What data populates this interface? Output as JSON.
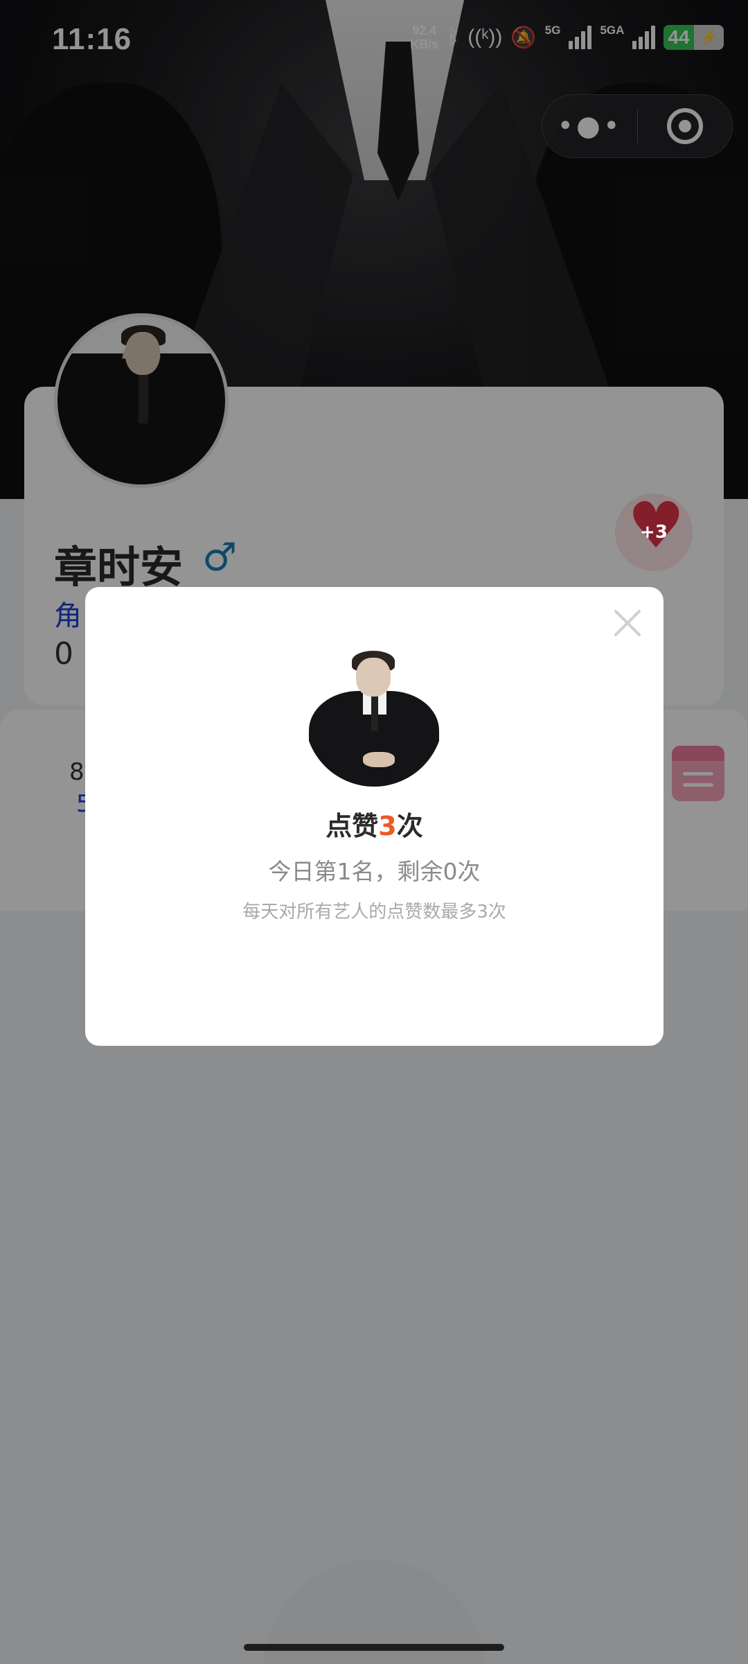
{
  "status_bar": {
    "time": "11:16",
    "net_speed_value": "92.4",
    "net_speed_unit": "KB/s",
    "network_1": "5G",
    "network_2": "5GA",
    "battery_level": "44"
  },
  "profile": {
    "name": "章时安",
    "gender_symbol": "♂",
    "role_partial": "角",
    "count_partial": "0",
    "like_badge": "+3"
  },
  "schedule": {
    "line1_partial": "8",
    "line2_partial": "5"
  },
  "modal": {
    "title_prefix": "点赞",
    "title_number": "3",
    "title_suffix": "次",
    "rank_text": "今日第1名，剩余0次",
    "rule_text": "每天对所有艺人的点赞数最多3次"
  },
  "colors": {
    "accent_orange": "#ee5a24",
    "role_blue": "#1e3fd8",
    "gender_blue": "#1a7fb5",
    "heart_red": "#e2344a",
    "calendar_pink": "#ee7a9b"
  }
}
